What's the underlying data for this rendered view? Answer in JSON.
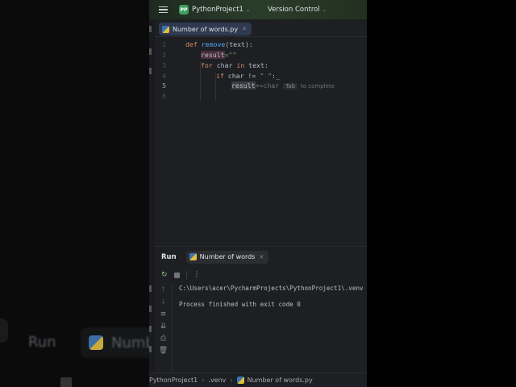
{
  "header": {
    "project_badge": "PP",
    "project_name": "PythonProject1",
    "vcs_label": "Version Control"
  },
  "editor": {
    "tab_label": "Number of words.py",
    "line_numbers": [
      "1",
      "2",
      "3",
      "4",
      "5",
      "6"
    ],
    "lines": {
      "l1_kw": "def",
      "l1_fn": "remove",
      "l1_rest": "(text):",
      "l2_var": "result",
      "l2_rest": "=\"\"",
      "l3_kw1": "for",
      "l3_a": " char ",
      "l3_kw2": "in",
      "l3_b": " text:",
      "l4_kw": "if",
      "l4_a": " char != ",
      "l4_str": "\" \"",
      "l4_b": ":_",
      "l5_var": "result",
      "l5_ghost": "+=char"
    },
    "completion_key": "Tab",
    "completion_hint": "to complete"
  },
  "run_panel": {
    "title": "Run",
    "tab_label": "Number of words",
    "output_lines": [
      "C:\\Users\\acer\\PycharmProjects\\PythonProject1\\.venv",
      "",
      "Process finished with exit code 0"
    ]
  },
  "breadcrumb": [
    "PythonProject1",
    ".venv",
    "Number of words.py"
  ],
  "background": {
    "run_label": "Run",
    "tab_fragment": "Numb"
  }
}
